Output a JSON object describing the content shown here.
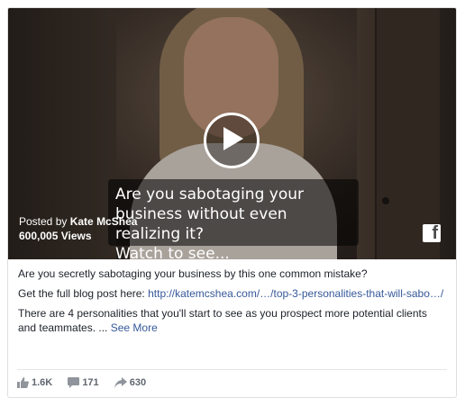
{
  "video": {
    "caption": "Are you sabotaging your\nbusiness without even realizing it?\nWatch to see...",
    "posted_prefix": "Posted by",
    "author": "Kate McShea",
    "views": "600,005 Views",
    "icons": [
      "play-icon",
      "facebook-icon"
    ]
  },
  "post": {
    "line1": "Are you secretly sabotaging your business by this one common mistake?",
    "line2_prefix": "Get the full blog post here:",
    "link": "http://katemcshea.com/…/top-3-personalities-that-will-sabo…/",
    "line3": "There are 4 personalities that you'll start to see as you prospect more potential clients and teammates. ...",
    "see_more": "See More"
  },
  "stats": {
    "likes": "1.6K",
    "comments": "171",
    "shares": "630",
    "icons": [
      "like-icon",
      "comment-icon",
      "share-icon"
    ]
  }
}
